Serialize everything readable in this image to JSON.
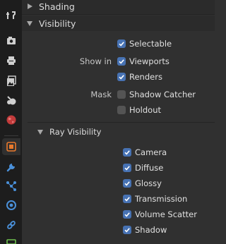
{
  "panels": {
    "shading": {
      "title": "Shading",
      "expanded": false
    },
    "visibility": {
      "title": "Visibility",
      "expanded": true,
      "selectable": {
        "label": "Selectable",
        "checked": true
      },
      "show_in": {
        "label": "Show in",
        "viewports": {
          "label": "Viewports",
          "checked": true
        },
        "renders": {
          "label": "Renders",
          "checked": true
        }
      },
      "mask": {
        "label": "Mask",
        "shadow_catcher": {
          "label": "Shadow Catcher",
          "checked": false
        },
        "holdout": {
          "label": "Holdout",
          "checked": false
        }
      }
    },
    "ray_visibility": {
      "title": "Ray Visibility",
      "expanded": true,
      "items": [
        {
          "label": "Camera",
          "checked": true
        },
        {
          "label": "Diffuse",
          "checked": true
        },
        {
          "label": "Glossy",
          "checked": true
        },
        {
          "label": "Transmission",
          "checked": true
        },
        {
          "label": "Volume Scatter",
          "checked": true
        },
        {
          "label": "Shadow",
          "checked": true
        }
      ]
    }
  },
  "tabs": [
    {
      "icon": "tool-icon"
    },
    {
      "icon": "render-icon"
    },
    {
      "icon": "output-icon"
    },
    {
      "icon": "view-layer-icon"
    },
    {
      "icon": "scene-icon"
    },
    {
      "icon": "world-icon"
    },
    {
      "icon": "object-icon",
      "active": true
    },
    {
      "icon": "modifier-icon"
    },
    {
      "icon": "particles-icon"
    },
    {
      "icon": "physics-icon"
    },
    {
      "icon": "constraints-icon"
    },
    {
      "icon": "data-icon"
    }
  ],
  "colors": {
    "accent": "#4772b3",
    "panel_bg": "#303030",
    "tab_strip_bg": "#1d1d1d",
    "object_tab_icon": "#e9792c",
    "world_tab_icon": "#c23b3b",
    "blue_tab_icon": "#4a90d9"
  }
}
